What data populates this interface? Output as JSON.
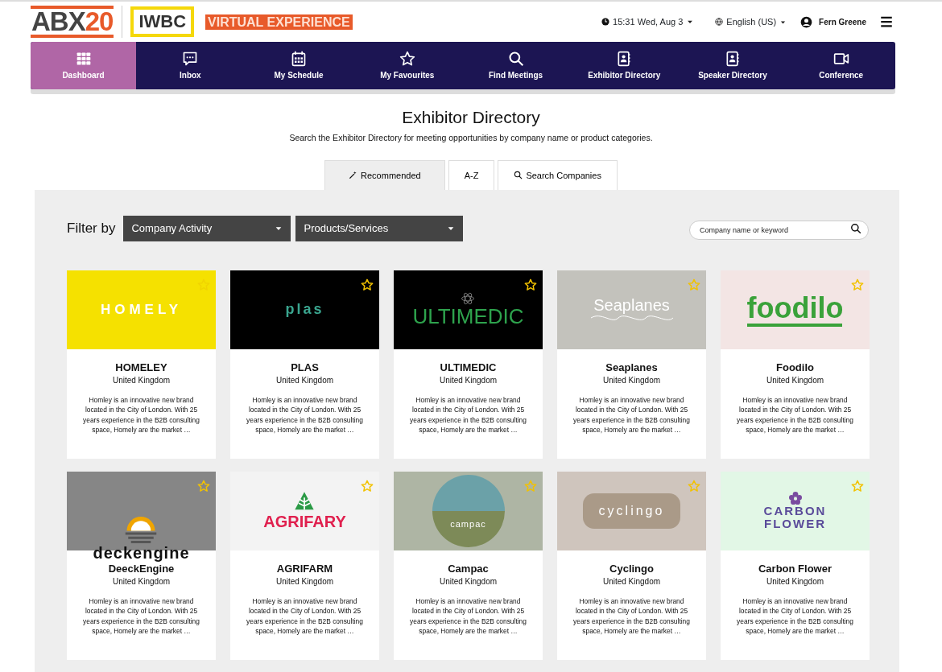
{
  "header": {
    "brand_abx": "ABX20",
    "brand_iwbc": "IWBC",
    "brand_tagline": "VIRTUAL EXPERIENCE",
    "clock": "15:31 Wed, Aug 3",
    "language": "English (US)",
    "user": "Fern Greene"
  },
  "nav": [
    {
      "label": "Dashboard",
      "kind": "grid",
      "selected": true
    },
    {
      "label": "Inbox",
      "kind": "chat",
      "selected": false
    },
    {
      "label": "My Schedule",
      "kind": "calendar",
      "selected": false
    },
    {
      "label": "My Favourites",
      "kind": "star",
      "selected": false
    },
    {
      "label": "Find Meetings",
      "kind": "search",
      "selected": false
    },
    {
      "label": "Exhibitor Directory",
      "kind": "contacts",
      "selected": false
    },
    {
      "label": "Speaker Directory",
      "kind": "contacts",
      "selected": false
    },
    {
      "label": "Conference",
      "kind": "video",
      "selected": false
    }
  ],
  "page": {
    "title": "Exhibitor Directory",
    "subtitle": "Search the Exhibitor Directory for meeting opportunities by company name or product categories."
  },
  "tabs": [
    {
      "label": "Recommended",
      "kind": "wand",
      "selected": true
    },
    {
      "label": "A-Z",
      "kind": "plain",
      "selected": false
    },
    {
      "label": "Search Companies",
      "kind": "search",
      "selected": false
    }
  ],
  "filters": {
    "label": "Filter by",
    "dropdowns": [
      "Company Activity",
      "Products/Services"
    ],
    "search": {
      "placeholder": "Company name or keyword"
    }
  },
  "exhibitors": [
    {
      "logo": {
        "text": "HOMELY",
        "kind": "homely"
      },
      "name": "HOMELEY",
      "country": "United Kingdom",
      "description": "Homley is an innovative new brand located in the City of London. With 25 years experience in the B2B consulting space, Homely are the market …",
      "favourite": false
    },
    {
      "logo": {
        "text": "plas",
        "kind": "plas"
      },
      "name": "PLAS",
      "country": "United Kingdom",
      "description": "Homley is an innovative new brand located in the City of London. With 25 years experience in the B2B consulting space, Homely are the market …",
      "favourite": false
    },
    {
      "logo": {
        "text": "ULTIMEDIC",
        "kind": "ultimedic"
      },
      "name": "ULTIMEDIC",
      "country": "United Kingdom",
      "description": "Homley is an innovative new brand located in the City of London. With 25 years experience in the B2B consulting space, Homely are the market …",
      "favourite": false
    },
    {
      "logo": {
        "text": "Seaplanes",
        "kind": "seaplanes"
      },
      "name": "Seaplanes",
      "country": "United Kingdom",
      "description": "Homley is an innovative new brand located in the City of London. With 25 years experience in the B2B consulting space, Homely are the market …",
      "favourite": false
    },
    {
      "logo": {
        "text": "foodilo",
        "kind": "foodilo"
      },
      "name": "Foodilo",
      "country": "United Kingdom",
      "description": "Homley is an innovative new brand located in the City of London. With 25 years experience in the B2B consulting space, Homely are the market …",
      "favourite": false
    },
    {
      "logo": {
        "text": "deckengine",
        "kind": "deckengine"
      },
      "name": "DeeckEngine",
      "country": "United Kingdom",
      "description": "Homley is an innovative new brand located in the City of London. With 25 years experience in the B2B consulting space, Homely are the market …",
      "favourite": false
    },
    {
      "logo": {
        "text": "AGRIFARY",
        "kind": "agrifary"
      },
      "name": "AGRIFARM",
      "country": "United Kingdom",
      "description": "Homley is an innovative new brand located in the City of London. With 25 years experience in the B2B consulting space, Homely are the market …",
      "favourite": false
    },
    {
      "logo": {
        "text": "campac",
        "kind": "campac"
      },
      "name": "Campac",
      "country": "United Kingdom",
      "description": "Homley is an innovative new brand located in the City of London. With 25 years experience in the B2B consulting space, Homely are the market …",
      "favourite": false
    },
    {
      "logo": {
        "text": "cyclingo",
        "kind": "cyclingo"
      },
      "name": "Cyclingo",
      "country": "United Kingdom",
      "description": "Homley is an innovative new brand located in the City of London. With 25 years experience in the B2B consulting space, Homely are the market …",
      "favourite": false
    },
    {
      "logo": {
        "text": "CARBON FLOWER",
        "kind": "carbon"
      },
      "name": "Carbon Flower",
      "country": "United Kingdom",
      "description": "Homley is an innovative new brand located in the City of London. With 25 years experience in the B2B consulting space, Homely are the market …",
      "favourite": false
    }
  ]
}
